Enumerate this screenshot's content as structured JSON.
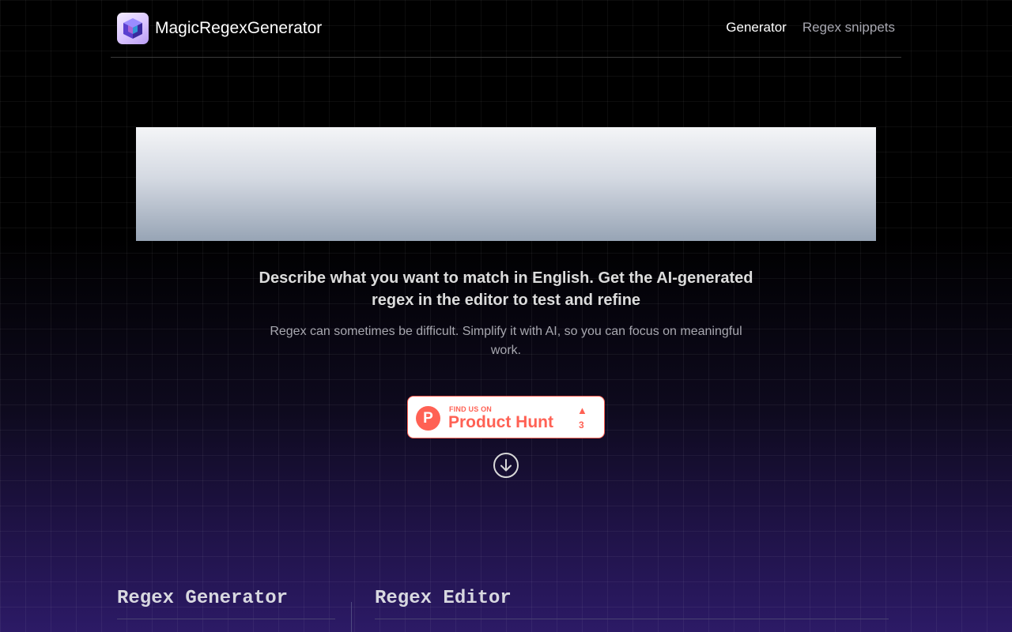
{
  "header": {
    "brand_name": "MagicRegexGenerator",
    "nav": [
      {
        "label": "Generator",
        "active": true
      },
      {
        "label": "Regex snippets",
        "active": false
      }
    ]
  },
  "hero": {
    "title": "Describe what you want to match in English. Get the AI-generated regex in the editor to test and refine",
    "subtitle": "Regex can sometimes be difficult. Simplify it with AI, so you can focus on meaningful work."
  },
  "product_hunt": {
    "logo_letter": "P",
    "small_text": "FIND US ON",
    "big_text": "Product Hunt",
    "upvote_arrow": "▲",
    "upvote_count": "3",
    "accent_color": "#ff6154"
  },
  "icons": {
    "logo": "cube-icon",
    "scroll": "arrow-down-circle-icon"
  },
  "sections": {
    "generator_title": "Regex Generator",
    "editor_title": "Regex Editor"
  },
  "colors": {
    "background_top": "#000000",
    "background_bottom": "#2c1a66",
    "nav_inactive": "#a7a7b0"
  }
}
